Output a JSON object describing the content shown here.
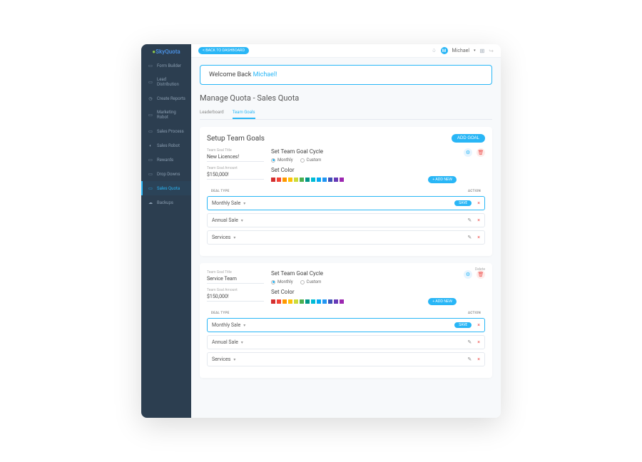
{
  "brand": {
    "text": "SkyQuota"
  },
  "topbar": {
    "back_label": "< BACK TO DASHBOARD",
    "user_name": "Michael",
    "user_initial": "M"
  },
  "welcome": {
    "greeting": "Welcome Back ",
    "name": "Michael!"
  },
  "page_title": "Manage Quota - Sales Quota",
  "tabs": {
    "leaderboard": "Leaderboard",
    "team_goals": "Team Goals"
  },
  "setup": {
    "title": "Setup Team Goals",
    "add_goal_label": "ADD GOAL"
  },
  "sidebar": {
    "items": [
      {
        "label": "Form Builder"
      },
      {
        "label": "Lead Distribution"
      },
      {
        "label": "Create Reports"
      },
      {
        "label": "Marketing Robot"
      },
      {
        "label": "Sales Process"
      },
      {
        "label": "Sales Robot"
      },
      {
        "label": "Rewards"
      },
      {
        "label": "Drop Downs"
      },
      {
        "label": "Sales Quota"
      },
      {
        "label": "Backups"
      }
    ]
  },
  "goal1": {
    "title_label": "Team Goal Title",
    "title_value": "New Licences!",
    "amount_label": "Team Goal Amount",
    "amount_value": "$150,000!",
    "cycle_title": "Set Team Goal Cycle",
    "monthly": "Monthly",
    "custom": "Custom",
    "color_title": "Set Color",
    "add_new": "+ ADD NEW",
    "head_type": "DEAL TYPE",
    "head_action": "ACTION",
    "rows": [
      {
        "name": "Monthly Sale"
      },
      {
        "name": "Annual Sale"
      },
      {
        "name": "Services"
      }
    ],
    "save": "SAVE"
  },
  "goal2": {
    "title_label": "Team Goal Title",
    "title_value": "Service Team",
    "amount_label": "Team Goal Amount",
    "amount_value": "$150,000!",
    "cycle_title": "Set Team Goal Cycle",
    "monthly": "Monthly",
    "custom": "Custom",
    "color_title": "Set Color",
    "add_new": "+ ADD NEW",
    "delete_label": "Delete",
    "head_type": "DEAL TYPE",
    "head_action": "ACTION",
    "rows": [
      {
        "name": "Monthly Sale"
      },
      {
        "name": "Annual Sale"
      },
      {
        "name": "Services"
      }
    ],
    "save": "SAVE"
  },
  "colors": {
    "swatches": [
      "#d32f2f",
      "#f44336",
      "#ff9800",
      "#ffc107",
      "#cddc39",
      "#4caf50",
      "#009688",
      "#00bcd4",
      "#03a9f4",
      "#2196f3",
      "#3f51b5",
      "#673ab7",
      "#9c27b0"
    ]
  }
}
